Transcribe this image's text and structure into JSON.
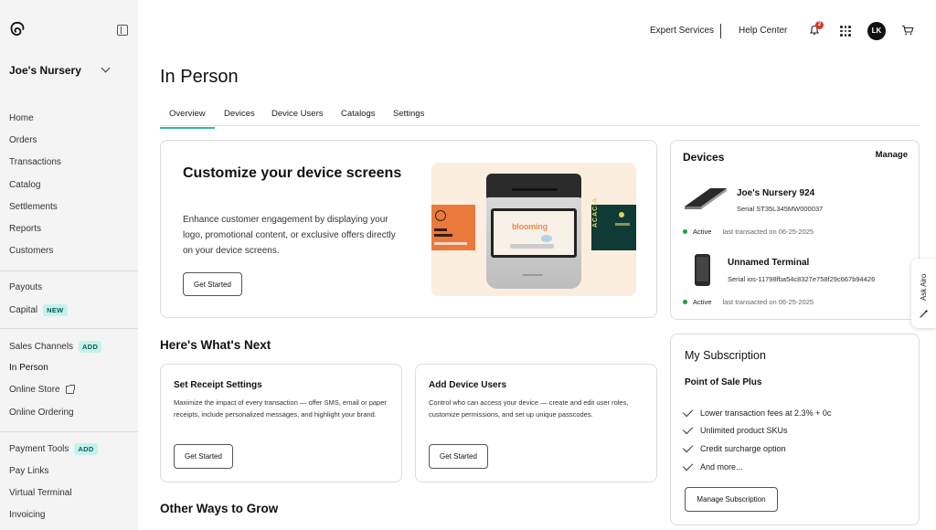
{
  "sidebar": {
    "store_name": "Joe's Nursery",
    "items": [
      {
        "label": "Home"
      },
      {
        "label": "Orders"
      },
      {
        "label": "Transactions"
      },
      {
        "label": "Catalog"
      },
      {
        "label": "Settlements"
      },
      {
        "label": "Reports"
      },
      {
        "label": "Customers"
      },
      {
        "label": "Payouts"
      },
      {
        "label": "Capital",
        "badge": "NEW"
      },
      {
        "label": "Sales Channels",
        "badge": "ADD"
      },
      {
        "label": "In Person",
        "active": true
      },
      {
        "label": "Online Store",
        "icon": "external-link-icon"
      },
      {
        "label": "Online Ordering"
      },
      {
        "label": "Payment Tools",
        "badge": "ADD"
      },
      {
        "label": "Pay Links"
      },
      {
        "label": "Virtual Terminal"
      },
      {
        "label": "Invoicing"
      }
    ]
  },
  "topbar": {
    "expert_services": "Expert Services",
    "help_center": "Help Center",
    "notification_count": "2",
    "avatar_initials": "LK",
    "icons": [
      "bell-icon",
      "apps-grid-icon",
      "cart-icon"
    ]
  },
  "page": {
    "title": "In Person",
    "tabs": [
      "Overview",
      "Devices",
      "Device Users",
      "Catalogs",
      "Settings"
    ],
    "active_tab": "Overview"
  },
  "hero": {
    "title": "Customize your device screens",
    "description": "Enhance customer engagement by displaying your logo, promotional content, or exclusive offers directly on your device screens.",
    "button": "Get Started",
    "screen_text": "blooming",
    "side_text": "ACACIA"
  },
  "whats_next": {
    "title": "Here's What's Next",
    "cards": [
      {
        "title": "Set Receipt Settings",
        "description": "Maximize the impact of every transaction — offer SMS, email or paper receipts, include personalized messages, and highlight your brand.",
        "button": "Get Started"
      },
      {
        "title": "Add Device Users",
        "description": "Control who can access your device — create and edit user roles, customize permissions, and set up unique passcodes.",
        "button": "Get Started"
      }
    ]
  },
  "other_ways": {
    "title": "Other Ways to Grow"
  },
  "devices": {
    "title": "Devices",
    "manage": "Manage",
    "items": [
      {
        "name": "Joe's Nursery 924",
        "serial": "Serial ST35L345MW000037",
        "status": "Active",
        "last": "last transacted on 06-25-2025"
      },
      {
        "name": "Unnamed Terminal",
        "serial": "Serial ios-11798fba54c8327e758f29c667b94426",
        "status": "Active",
        "last": "last transacted on 06-25-2025"
      }
    ]
  },
  "subscription": {
    "title": "My Subscription",
    "plan": "Point of Sale Plus",
    "features": [
      "Lower transaction fees at 2.3% + 0c",
      "Unlimited product SKUs",
      "Credit surcharge option",
      "And more..."
    ],
    "button": "Manage Subscription"
  },
  "airo": {
    "label": "Ask Airo"
  },
  "colors": {
    "accent": "#36b5a6",
    "status_active": "#1e9e4a",
    "badge_bg": "#c6f2ec"
  }
}
